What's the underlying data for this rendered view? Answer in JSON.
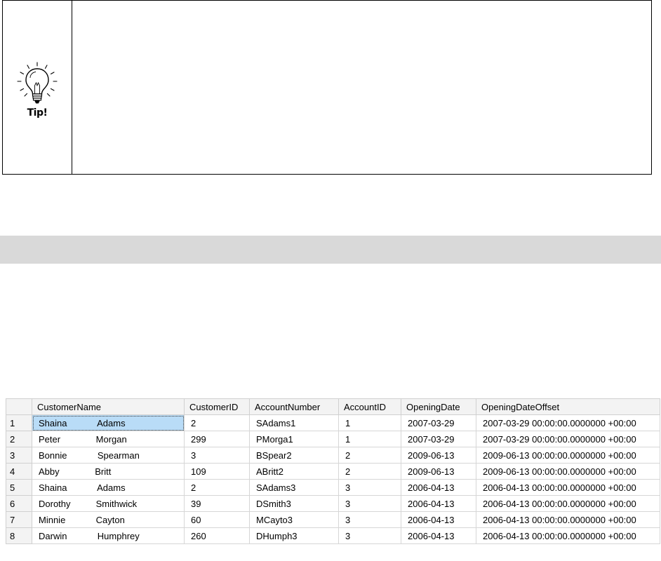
{
  "tip": {
    "label": "Tip!"
  },
  "grid": {
    "columns": [
      "",
      "CustomerName",
      "CustomerID",
      "AccountNumber",
      "AccountID",
      "OpeningDate",
      "OpeningDateOffset"
    ],
    "rows": [
      {
        "num": "1",
        "name": "Shaina            Adams",
        "customer_id": "2",
        "account_number": "SAdams1",
        "account_id": "1",
        "opening_date": "2007-03-29",
        "opening_offset": "2007-03-29 00:00:00.0000000 +00:00"
      },
      {
        "num": "2",
        "name": "Peter              Morgan",
        "customer_id": "299",
        "account_number": "PMorga1",
        "account_id": "1",
        "opening_date": "2007-03-29",
        "opening_offset": "2007-03-29 00:00:00.0000000 +00:00"
      },
      {
        "num": "3",
        "name": "Bonnie            Spearman",
        "customer_id": "3",
        "account_number": "BSpear2",
        "account_id": "2",
        "opening_date": "2009-06-13",
        "opening_offset": "2009-06-13 00:00:00.0000000 +00:00"
      },
      {
        "num": "4",
        "name": "Abby              Britt",
        "customer_id": "109",
        "account_number": "ABritt2",
        "account_id": "2",
        "opening_date": "2009-06-13",
        "opening_offset": "2009-06-13 00:00:00.0000000 +00:00"
      },
      {
        "num": "5",
        "name": "Shaina            Adams",
        "customer_id": "2",
        "account_number": "SAdams3",
        "account_id": "3",
        "opening_date": "2006-04-13",
        "opening_offset": "2006-04-13 00:00:00.0000000 +00:00"
      },
      {
        "num": "6",
        "name": "Dorothy          Smithwick",
        "customer_id": "39",
        "account_number": "DSmith3",
        "account_id": "3",
        "opening_date": "2006-04-13",
        "opening_offset": "2006-04-13 00:00:00.0000000 +00:00"
      },
      {
        "num": "7",
        "name": "Minnie            Cayton",
        "customer_id": "60",
        "account_number": "MCayto3",
        "account_id": "3",
        "opening_date": "2006-04-13",
        "opening_offset": "2006-04-13 00:00:00.0000000 +00:00"
      },
      {
        "num": "8",
        "name": "Darwin            Humphrey",
        "customer_id": "260",
        "account_number": "DHumph3",
        "account_id": "3",
        "opening_date": "2006-04-13",
        "opening_offset": "2006-04-13 00:00:00.0000000 +00:00"
      }
    ]
  }
}
